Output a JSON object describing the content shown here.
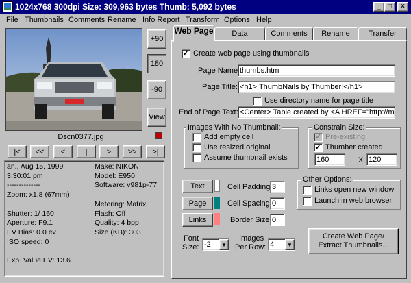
{
  "window": {
    "title": "1024x768  300dpi  Size: 309,963 bytes  Thumb: 5,092 bytes",
    "minimize": "_",
    "maximize": "□",
    "close": "×"
  },
  "menu": [
    "File",
    "Thumbnails",
    "Comments",
    "Rename",
    "Info Report",
    "Transform",
    "Options",
    "Help"
  ],
  "left": {
    "rotate_buttons": [
      "+90",
      "180",
      "-90"
    ],
    "view_button": "View",
    "filename": "Dscn0377.jpg",
    "nav_buttons": [
      "|<",
      "<<",
      "<",
      "|",
      ">",
      ">>",
      ">|"
    ],
    "info_left": "an., Aug 15, 1999\n3:30:01 pm\n--------------\nZoom: x1.8 (67mm)\n\nShutter: 1/ 160\nAperture: F9.1\nEV Bias: 0.0 ev\nISO speed: 0\n\nExp. Value EV: 13.6",
    "info_right": "Make: NIKON\nModel: E950\nSoftware: v981p-77\n\nMetering: Matrix\nFlash: Off\nQuality: 4 bpp\nSize (KB): 303"
  },
  "tabs": [
    "Web Page",
    "Data",
    "Comments",
    "Rename",
    "Transfer"
  ],
  "web": {
    "create_web_page": "Create web page using thumbnails",
    "page_name_label": "Page Name:",
    "page_name_value": "thumbs.htm",
    "page_title_label": "Page Title:",
    "page_title_value": "<h1> ThumbNails by Thumber!</h1>",
    "use_dir_name": "Use directory name for page title",
    "end_text_label": "End of Page Text:",
    "end_text_value": "<Center> Table created by <A HREF=\"http://me",
    "no_thumb_group": "Images With No Thumbnail:",
    "add_empty_cell": "Add empty cell",
    "use_resized": "Use resized original",
    "assume_exists": "Assume thumbnail exists",
    "constrain_group": "Constrain Size:",
    "pre_existing": "Pre-existing",
    "thumber_created": "Thumber created",
    "width": "160",
    "times": "X",
    "height": "120",
    "text_button": "Text",
    "page_button": "Page",
    "links_button": "Links",
    "cell_padding_label": "Cell Padding:",
    "cell_padding": "3",
    "cell_spacing_label": "Cell Spacing:",
    "cell_spacing": "0",
    "border_size_label": "Border Size:",
    "border_size": "0",
    "other_group": "Other Options:",
    "links_new_window": "Links open new window",
    "launch_browser": "Launch in web browser",
    "font_size_label_1": "Font",
    "font_size_label_2": "Size:",
    "font_size": "-2",
    "images_per_row_1": "Images",
    "images_per_row_2": "Per Row:",
    "images_per_row": "4",
    "create_button_1": "Create Web Page/",
    "create_button_2": "Extract Thumbnails..."
  },
  "colors": {
    "title_bar": "#000080",
    "text_swatch": "#ffffff",
    "page_swatch": "#008080",
    "links_swatch": "#ff8080"
  }
}
